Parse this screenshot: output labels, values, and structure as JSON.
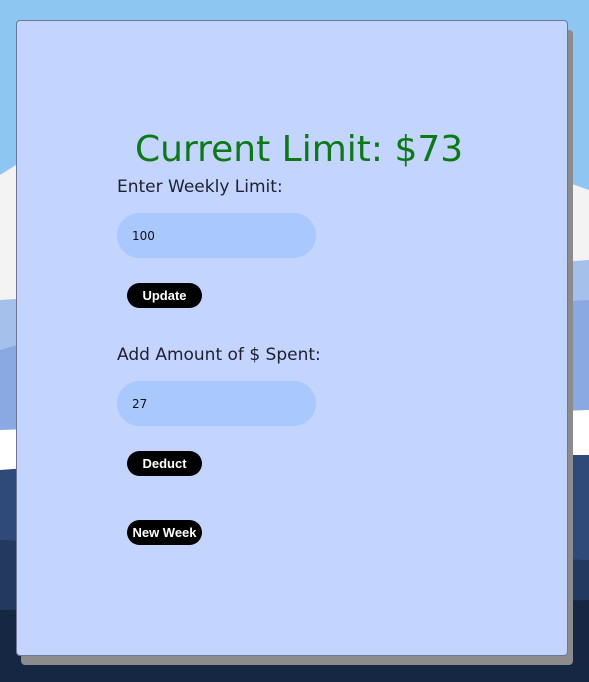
{
  "budget": {
    "current_limit_text": "Current Limit: $73",
    "weekly_limit_label": "Enter Weekly Limit:",
    "weekly_limit_value": "100",
    "update_button": "Update",
    "spent_label": "Add Amount of $ Spent:",
    "spent_value": "27",
    "deduct_button": "Deduct",
    "new_week_button": "New Week"
  },
  "colors": {
    "card_background": "#c3d4fe",
    "limit_text": "#0b7a15",
    "input_background": "#a9c8fd",
    "button_background": "#000000",
    "sky": "#8ec6f2"
  }
}
